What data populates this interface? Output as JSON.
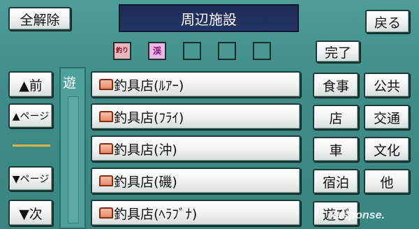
{
  "header": {
    "clear_all_label": "全解除",
    "title": "周辺施設",
    "back_label": "戻る",
    "done_label": "完了"
  },
  "filter_chips": [
    {
      "label": "釣り",
      "color": "#e8b8c0",
      "filled": true
    },
    {
      "label": "渓",
      "color": "#e8b8e6",
      "filled": true
    },
    {
      "label": "",
      "filled": false
    },
    {
      "label": "",
      "filled": false
    },
    {
      "label": "",
      "filled": false
    }
  ],
  "nav": {
    "prev_label": "▲前",
    "page_up_label": "▲ページ",
    "page_down_label": "▼ページ",
    "next_label": "▼次"
  },
  "category_column_label": "遊",
  "list_items": [
    {
      "label": "釣具店(ﾙｱｰ)"
    },
    {
      "label": "釣具店(ﾌﾗｲ)"
    },
    {
      "label": "釣具店(沖)"
    },
    {
      "label": "釣具店(磯)"
    },
    {
      "label": "釣具店(ﾍﾗﾌﾞﾅ)"
    }
  ],
  "categories": [
    {
      "label": "食事"
    },
    {
      "label": "公共"
    },
    {
      "label": "店"
    },
    {
      "label": "交通"
    },
    {
      "label": "車"
    },
    {
      "label": "文化"
    },
    {
      "label": "宿泊"
    },
    {
      "label": "他"
    },
    {
      "label": "遊び"
    }
  ],
  "watermark": "Response."
}
